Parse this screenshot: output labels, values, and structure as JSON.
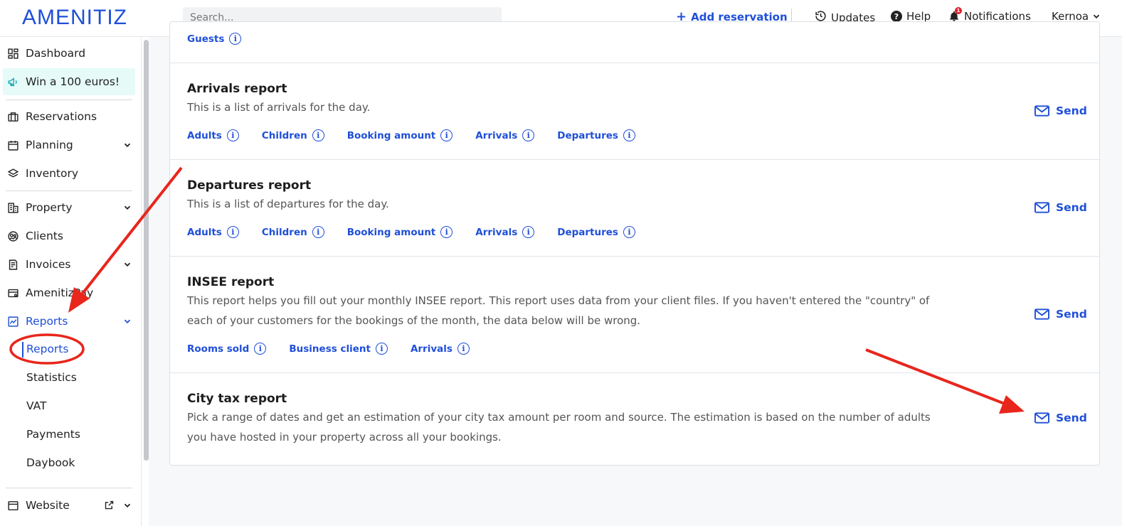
{
  "header": {
    "logo": "AMENITIZ",
    "search_placeholder": "Search...",
    "add_reservation": "Add reservation",
    "updates": "Updates",
    "help": "Help",
    "notifications": "Notifications",
    "notifications_count": "1",
    "user": "Kernoa"
  },
  "sidebar": {
    "dashboard": "Dashboard",
    "promo": "Win a 100 euros!",
    "reservations": "Reservations",
    "planning": "Planning",
    "inventory": "Inventory",
    "property": "Property",
    "clients": "Clients",
    "invoices": "Invoices",
    "amenitizpay": "AmenitizPay",
    "reports": "Reports",
    "sub": {
      "reports": "Reports",
      "statistics": "Statistics",
      "vat": "VAT",
      "payments": "Payments",
      "daybook": "Daybook"
    },
    "website": "Website"
  },
  "reports": {
    "top_partial_tag": "Guests",
    "send_label": "Send",
    "items": [
      {
        "title": "Arrivals report",
        "desc": "This is a list of arrivals for the day.",
        "tags": [
          "Adults",
          "Children",
          "Booking amount",
          "Arrivals",
          "Departures"
        ]
      },
      {
        "title": "Departures report",
        "desc": "This is a list of departures for the day.",
        "tags": [
          "Adults",
          "Children",
          "Booking amount",
          "Arrivals",
          "Departures"
        ]
      },
      {
        "title": "INSEE report",
        "desc": "This report helps you fill out your monthly INSEE report. This report uses data from your client files. If you haven't entered the \"country\" of each of your customers for the bookings of the month, the data below will be wrong.",
        "tags": [
          "Rooms sold",
          "Business client",
          "Arrivals"
        ]
      },
      {
        "title": "City tax report",
        "desc": "Pick a range of dates and get an estimation of your city tax amount per room and source. The estimation is based on the number of adults you have hosted in your property across all your bookings.",
        "tags": []
      }
    ]
  },
  "colors": {
    "accent": "#1f4fd8",
    "annotation": "#e8261c",
    "promo_bg": "#e6fbf8"
  }
}
